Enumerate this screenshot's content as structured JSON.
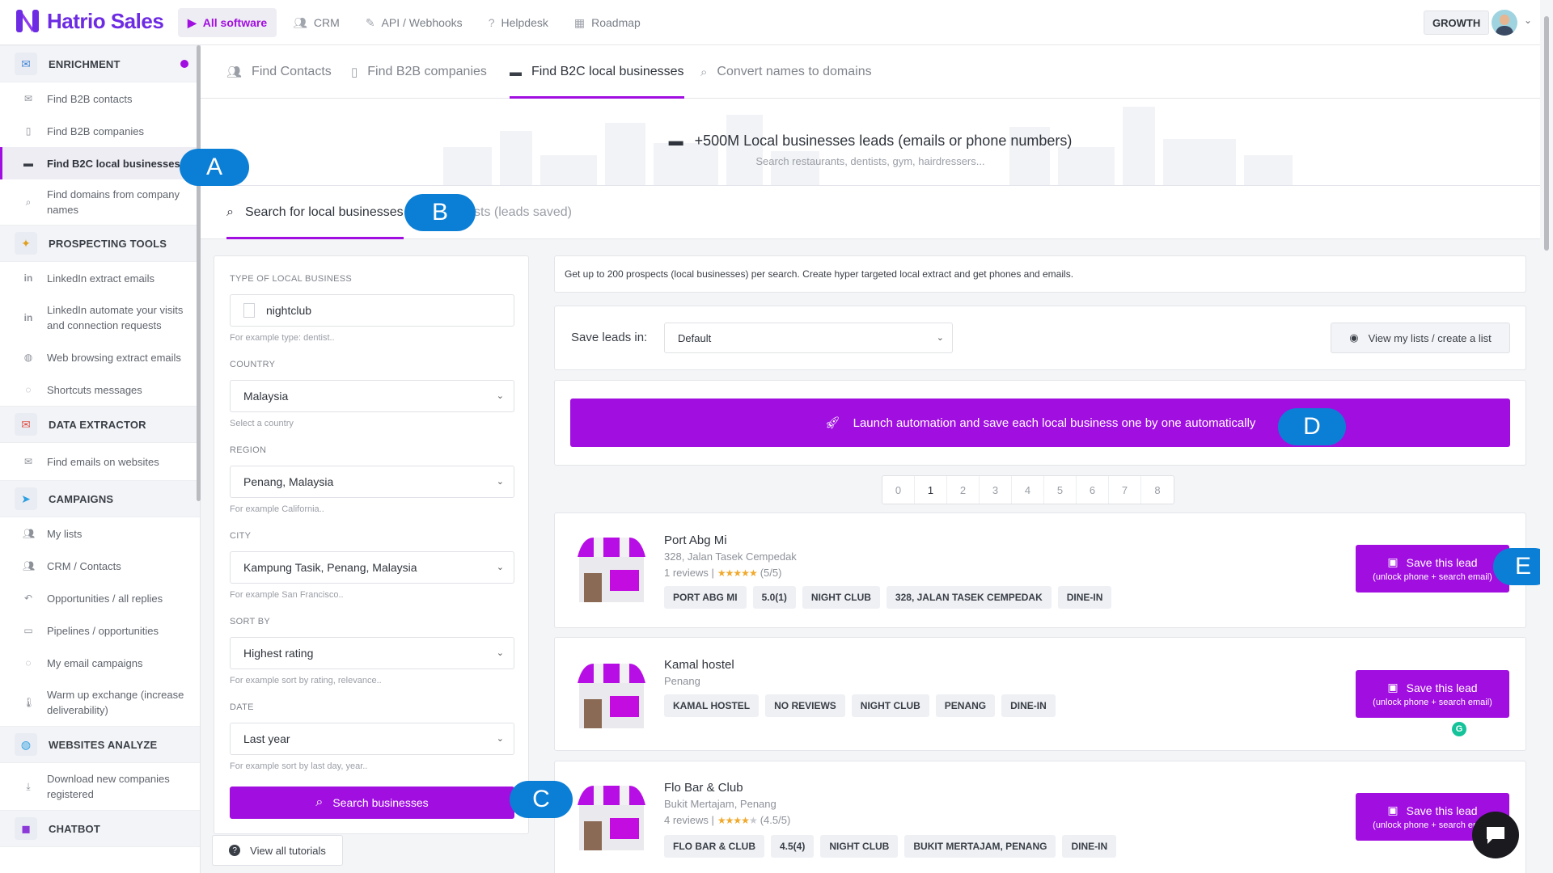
{
  "app": {
    "name": "Hatrio Sales",
    "plan": "GROWTH"
  },
  "topnav": [
    {
      "label": "All software",
      "icon": "play-icon",
      "active": true
    },
    {
      "label": "CRM",
      "icon": "users-icon"
    },
    {
      "label": "API / Webhooks",
      "icon": "plug-icon"
    },
    {
      "label": "Helpdesk",
      "icon": "help-icon"
    },
    {
      "label": "Roadmap",
      "icon": "calendar-icon"
    }
  ],
  "sidebar": {
    "sections": {
      "enrichment": "ENRICHMENT",
      "prospecting": "PROSPECTING TOOLS",
      "extractor": "DATA EXTRACTOR",
      "campaigns": "CAMPAIGNS",
      "websites": "WEBSITES ANALYZE",
      "chatbot": "CHATBOT"
    },
    "items": {
      "b2b_contacts": "Find B2B contacts",
      "b2b_companies": "Find B2B companies",
      "b2c_local": "Find B2C local businesses",
      "domains": "Find domains from company names",
      "linkedin_extract": "LinkedIn extract emails",
      "linkedin_automate": "LinkedIn automate your visits and connection requests",
      "web_browsing": "Web browsing extract emails",
      "shortcuts": "Shortcuts messages",
      "emails_websites": "Find emails on websites",
      "my_lists": "My lists",
      "crm_contacts": "CRM / Contacts",
      "opportunities": "Opportunities / all replies",
      "pipelines": "Pipelines / opportunities",
      "email_campaigns": "My email campaigns",
      "warm_up": "Warm up exchange (increase deliverability)",
      "download_companies": "Download new companies registered"
    }
  },
  "tabs": [
    "Find Contacts",
    "Find B2B companies",
    "Find B2C local businesses",
    "Convert names to domains"
  ],
  "hero": {
    "title": "+500M Local businesses leads (emails or phone numbers)",
    "subtitle": "Search restaurants, dentists, gym, hairdressers..."
  },
  "subtabs": {
    "search": "Search for local businesses",
    "lists": "sts (leads saved)"
  },
  "form": {
    "type_label": "TYPE OF LOCAL BUSINESS",
    "type_value": "nightclub",
    "type_help": "For example type: dentist..",
    "country_label": "COUNTRY",
    "country_value": "Malaysia",
    "country_help": "Select a country",
    "region_label": "REGION",
    "region_value": "Penang, Malaysia",
    "region_help": "For example California..",
    "city_label": "CITY",
    "city_value": "Kampung Tasik, Penang, Malaysia",
    "city_help": "For example San Francisco..",
    "sort_label": "SORT BY",
    "sort_value": "Highest rating",
    "sort_help": "For example sort by rating, relevance..",
    "date_label": "DATE",
    "date_value": "Last year",
    "date_help": "For example sort by last day, year..",
    "search_button": "Search businesses"
  },
  "tutorials_button": "View all tutorials",
  "info_text": "Get up to 200 prospects (local businesses) per search. Create hyper targeted local extract and get phones and emails.",
  "save_leads": {
    "label": "Save leads in:",
    "list_value": "Default",
    "view_button": "View my lists / create a list"
  },
  "automation_button": "Launch automation and save each local business one by one automatically",
  "pages": [
    "0",
    "1",
    "2",
    "3",
    "4",
    "5",
    "6",
    "7",
    "8"
  ],
  "current_page": "1",
  "results": [
    {
      "name": "Port Abg Mi",
      "address": "328, Jalan Tasek Cempedak",
      "reviews": "1 reviews |",
      "rating_text": "(5/5)",
      "rating": 5,
      "tags": [
        "PORT ABG MI",
        "5.0(1)",
        "NIGHT CLUB",
        "328, JALAN TASEK CEMPEDAK",
        "DINE-IN"
      ]
    },
    {
      "name": "Kamal hostel",
      "address": "Penang",
      "tags": [
        "KAMAL HOSTEL",
        "NO REVIEWS",
        "NIGHT CLUB",
        "PENANG",
        "DINE-IN"
      ]
    },
    {
      "name": "Flo Bar & Club",
      "address": "Bukit Mertajam, Penang",
      "reviews": "4 reviews |",
      "rating_text": "(4.5/5)",
      "rating": 4.5,
      "tags": [
        "FLO BAR & CLUB",
        "4.5(4)",
        "NIGHT CLUB",
        "BUKIT MERTAJAM, PENANG",
        "DINE-IN"
      ]
    }
  ],
  "save_lead": {
    "title": "Save this lead",
    "subtitle": "(unlock phone + search email)"
  },
  "markers": [
    "A",
    "B",
    "C",
    "D",
    "E"
  ],
  "colors": {
    "accent": "#a10ee0",
    "brand": "#6d2be3",
    "marker": "#0b7fd6"
  }
}
